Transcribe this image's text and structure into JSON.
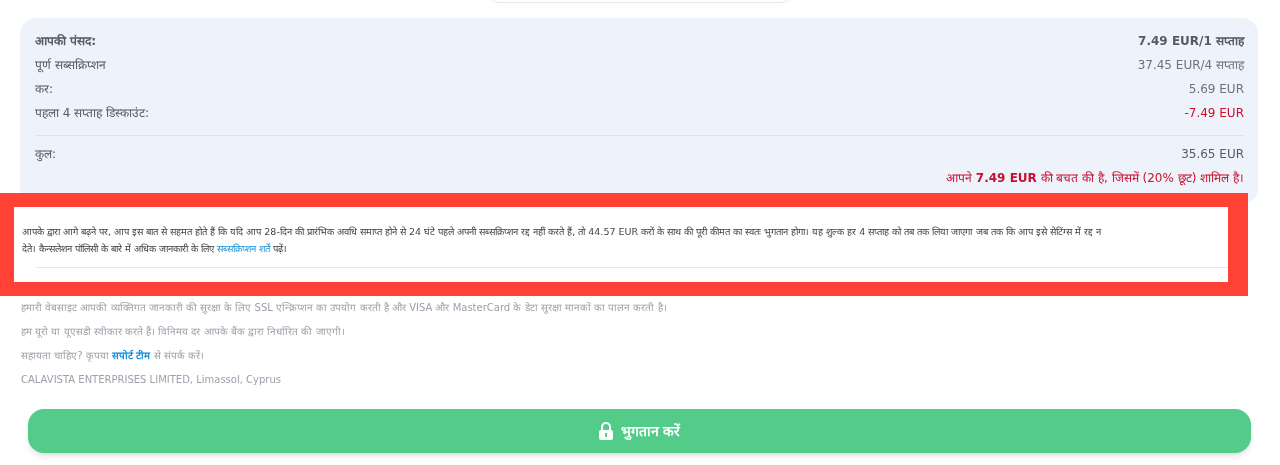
{
  "summary": {
    "rows": [
      {
        "label": "आपकी पंसद:",
        "value": "7.49 EUR/1 सप्ताह",
        "kind": "header"
      },
      {
        "label": "पूर्ण सब्सक्रिप्शन",
        "value": "37.45 EUR/4 सप्ताह",
        "kind": "normal"
      },
      {
        "label": "कर:",
        "value": "5.69 EUR",
        "kind": "normal"
      },
      {
        "label": "पहला 4 सप्ताह डिस्काउंट:",
        "value": "-7.49 EUR",
        "kind": "discount"
      }
    ],
    "total": {
      "label": "कुल:",
      "value": "35.65 EUR"
    },
    "savings": "आपने **7.49 EUR** की बचत की है, जिसमें (20% छूट) शामिल है।"
  },
  "notice": {
    "line_1": "आपके द्वारा आगे बढ़ने पर, आप इस बात से सहमत होते हैं कि यदि आप 28-दिन की प्रारंभिक अवधि समाप्त होने से 24 घंटे पहले अपनी सब्सक्रिप्शन रद्द नहीं करते हैं, तो 44.57 EUR करों के साथ की पूरी कीमत का स्वतः भुगतान होगा। यह शुल्क हर 4 सप्ताह को तब तक लिया जाएगा जब तक कि आप इसे सेटिंग्स में रद्द न",
    "line_2_before": "देते। कैन्सलेशन पॉलिसी के बारे में अधिक जानकारी के लिए ",
    "link": "सब्सक्रिप्शन शर्तें",
    "line_2_after": "पढ़ें।"
  },
  "footer": {
    "security": "हमारी वेबसाइट आपकी व्यक्तिगत जानकारी की सुरक्षा के लिए SSL एन्क्रिप्शन का उपयोग करती है और VISA और MasterCard के डेटा सुरक्षा मानकों का पालन करती है।",
    "currency": "हम यूरो या यूएसडी स्वीकार करते हैं। विनिमय दर आपके बैंक द्वारा निर्धारित की जाएगी।",
    "support_before": "सहायता चाहिए? कृपया ",
    "support_link": "सपोर्ट टीम",
    "support_after": " से संपर्क करें।",
    "company": "CALAVISTA ENTERPRISES LIMITED, Limassol, Cyprus"
  },
  "pay_button": {
    "label": "भुगतान करें"
  }
}
